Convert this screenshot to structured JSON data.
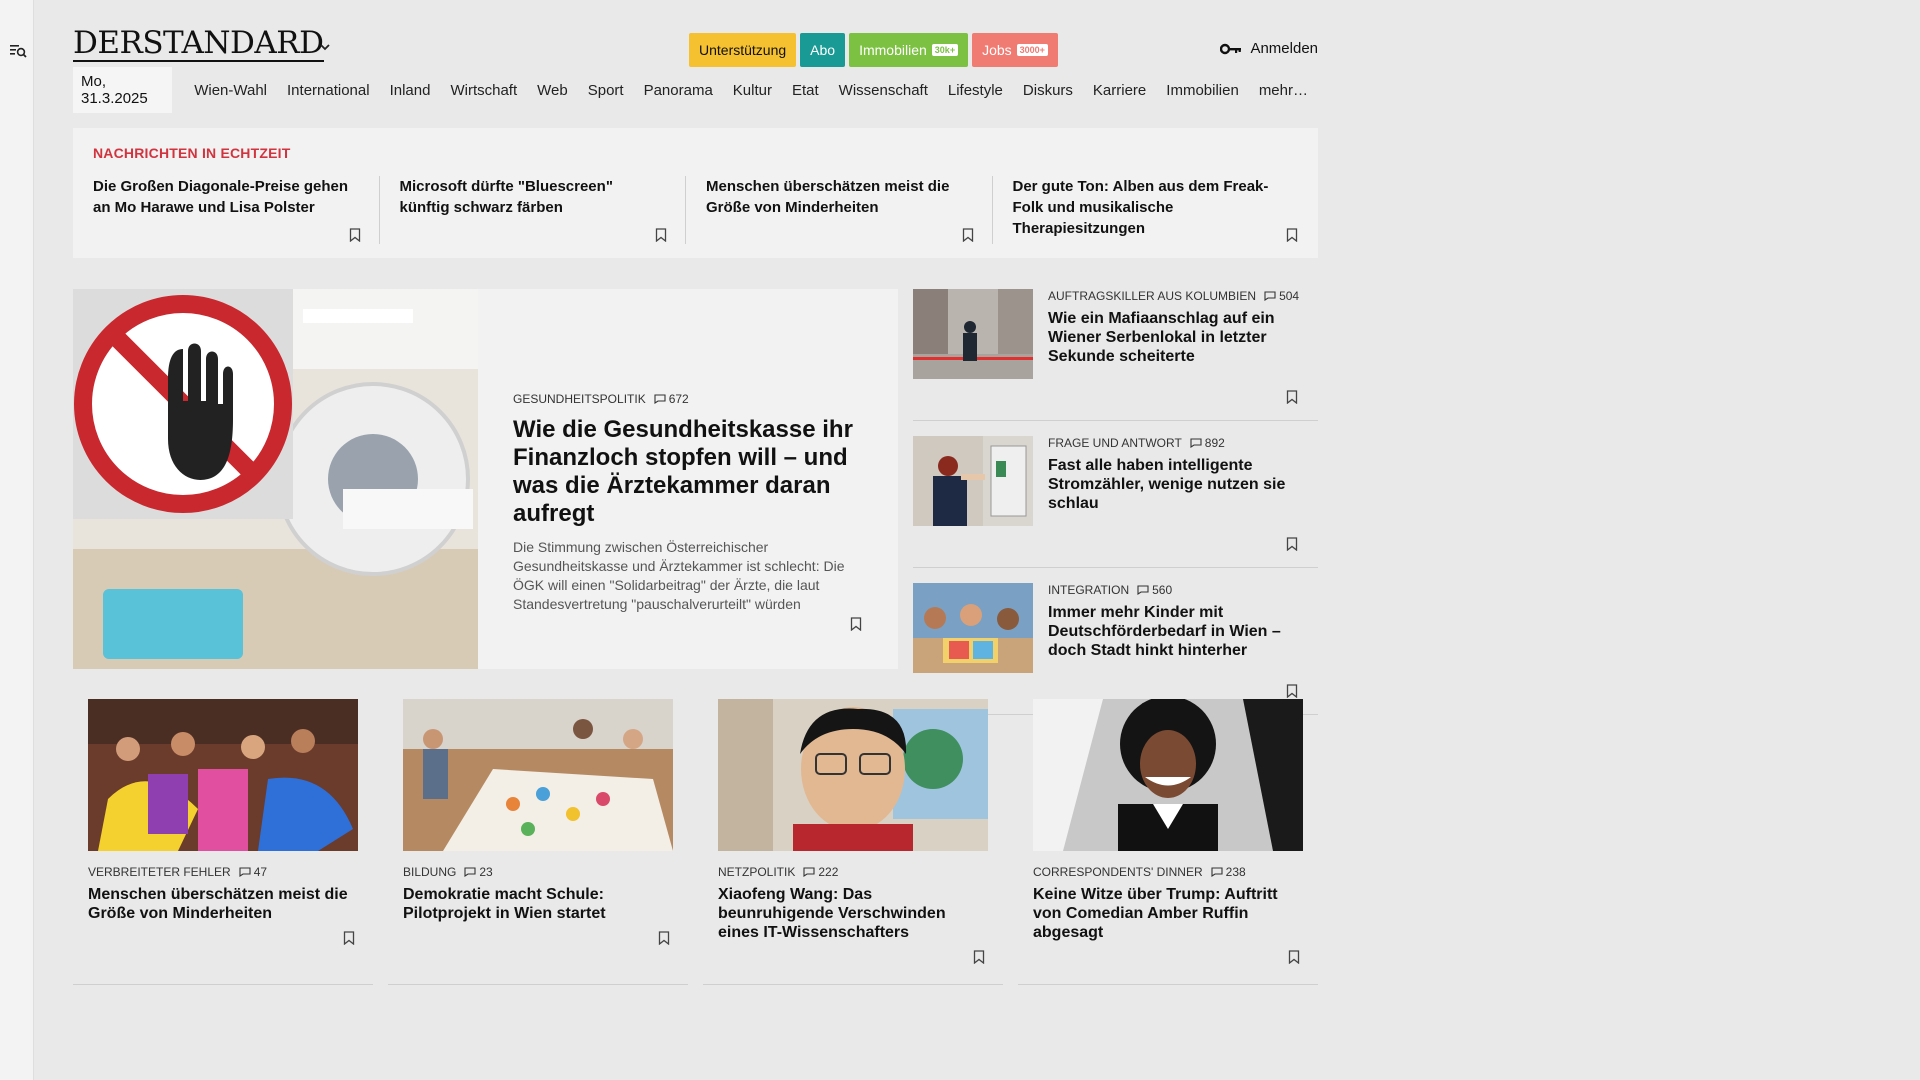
{
  "brand": {
    "logo": "DERSTANDARD"
  },
  "header": {
    "pills": [
      {
        "label": "Unterstützung",
        "tag": "",
        "bg": "#f5c130",
        "fg": "#111111"
      },
      {
        "label": "Abo",
        "tag": "",
        "bg": "#1a9a94",
        "fg": "#ffffff"
      },
      {
        "label": "Immobilien",
        "tag": "30k+",
        "bg": "#7cc142",
        "fg": "#ffffff"
      },
      {
        "label": "Jobs",
        "tag": "3000+",
        "bg": "#f07b73",
        "fg": "#ffffff"
      }
    ],
    "login_label": "Anmelden"
  },
  "nav": {
    "date": "Mo, 31.3.2025",
    "items": [
      "Wien-Wahl",
      "International",
      "Inland",
      "Wirtschaft",
      "Web",
      "Sport",
      "Panorama",
      "Kultur",
      "Etat",
      "Wissenschaft",
      "Lifestyle",
      "Diskurs",
      "Karriere",
      "Immobilien",
      "mehr…"
    ]
  },
  "ticker": {
    "title": "NACHRICHTEN IN ECHTZEIT",
    "items": [
      "Die Großen Diagonale-Preise gehen an Mo Harawe und Lisa Polster",
      "Microsoft dürfte \"Bluescreen\" künftig schwarz färben",
      "Menschen überschätzen meist die Größe von Minderheiten",
      "Der gute Ton: Alben aus dem Freak-Folk und musikalische Therapiesitzungen"
    ]
  },
  "hero": {
    "kicker": "GESUNDHEITSPOLITIK",
    "comments": "672",
    "title": "Wie die Gesundheitskasse ihr Finanzloch stopfen will – und was die Ärztekammer daran aufregt",
    "lead": "Die Stimmung zwischen Österreichischer Gesundheitskasse und Ärztekammer ist schlecht: Die ÖGK will einen \"Solidarbeitrag\" der Ärzte, die laut Standesvertretung \"pauschalverurteilt\" würden"
  },
  "side": [
    {
      "kicker": "AUFTRAGSKILLER AUS KOLUMBIEN",
      "comments": "504",
      "title": "Wie ein Mafiaanschlag auf ein Wiener Serbenlokal in letzter Sekunde scheiterte"
    },
    {
      "kicker": "FRAGE UND ANTWORT",
      "comments": "892",
      "title": "Fast alle haben intelligente Stromzähler, wenige nutzen sie schlau"
    },
    {
      "kicker": "INTEGRATION",
      "comments": "560",
      "title": "Immer mehr Kinder mit Deutschförderbedarf in Wien – doch Stadt hinkt hinterher"
    }
  ],
  "cards": [
    {
      "kicker": "VERBREITETER FEHLER",
      "comments": "47",
      "title": "Menschen überschätzen meist die Größe von Minderheiten"
    },
    {
      "kicker": "BILDUNG",
      "comments": "23",
      "title": "Demokratie macht Schule: Pilotprojekt in Wien startet"
    },
    {
      "kicker": "NETZPOLITIK",
      "comments": "222",
      "title": "Xiaofeng Wang: Das beunruhigende Verschwinden eines IT-Wissenschafters"
    },
    {
      "kicker": "CORRESPONDENTS' DINNER",
      "comments": "238",
      "title": "Keine Witze über Trump: Auftritt von Comedian Amber Ruffin abgesagt"
    }
  ],
  "colors": {
    "accent_red": "#d1343f",
    "panel_bg": "#f2f2f2",
    "page_bg": "#e9e9e9"
  }
}
